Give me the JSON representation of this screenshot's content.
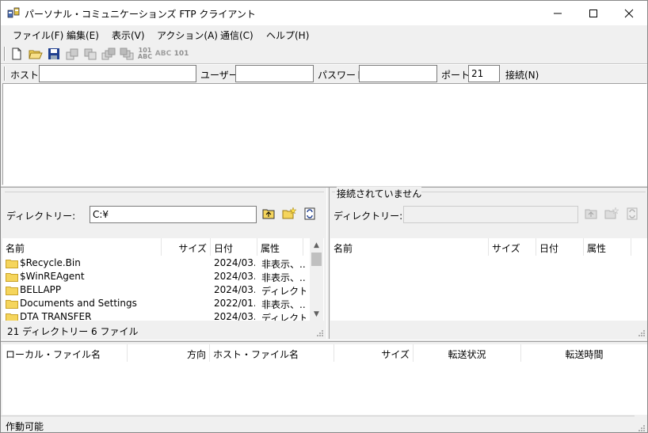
{
  "window": {
    "title": "パーソナル・コミュニケーションズ FTP クライアント"
  },
  "menu": [
    "ファイル(F)",
    "編集(E)",
    "表示(V)",
    "アクション(A)",
    "通信(C)",
    "ヘルプ(H)"
  ],
  "toolbar": {
    "text_icons": [
      "101 ABC",
      "ABC",
      "101"
    ]
  },
  "connection": {
    "host_label": "ホスト:",
    "host_value": "",
    "user_label": "ユーザー:",
    "user_value": "",
    "password_label": "パスワード:",
    "password_value": "",
    "port_label": "ポート:",
    "port_value": "21",
    "connect_label": "接続(N)"
  },
  "local": {
    "dir_label": "ディレクトリー:",
    "dir_value": "C:¥",
    "columns": [
      "名前",
      "サイズ",
      "日付",
      "属性"
    ],
    "rows": [
      {
        "name": "$Recycle.Bin",
        "size": "",
        "date": "2024/03...",
        "attr": "非表示、..."
      },
      {
        "name": "$WinREAgent",
        "size": "",
        "date": "2024/03...",
        "attr": "非表示、..."
      },
      {
        "name": "BELLAPP",
        "size": "",
        "date": "2024/03...",
        "attr": "ディレクト..."
      },
      {
        "name": "Documents and Settings",
        "size": "",
        "date": "2022/01...",
        "attr": "非表示、..."
      },
      {
        "name": "DTA TRANSFER",
        "size": "",
        "date": "2024/03...",
        "attr": "ディレクト..."
      }
    ],
    "status": "21 ディレクトリー 6 ファイル"
  },
  "remote": {
    "group_title": "接続されていません",
    "dir_label": "ディレクトリー:",
    "dir_value": "",
    "columns": [
      "名前",
      "サイズ",
      "日付",
      "属性"
    ]
  },
  "transfer": {
    "columns": [
      "ローカル・ファイル名",
      "方向",
      "ホスト・ファイル名",
      "サイズ",
      "転送状況",
      "転送時間"
    ]
  },
  "statusbar": {
    "text": "作動可能"
  },
  "colors": {
    "folder": "#f5d55c",
    "folder_edge": "#c9a227",
    "floppy": "#1f3f8f"
  }
}
